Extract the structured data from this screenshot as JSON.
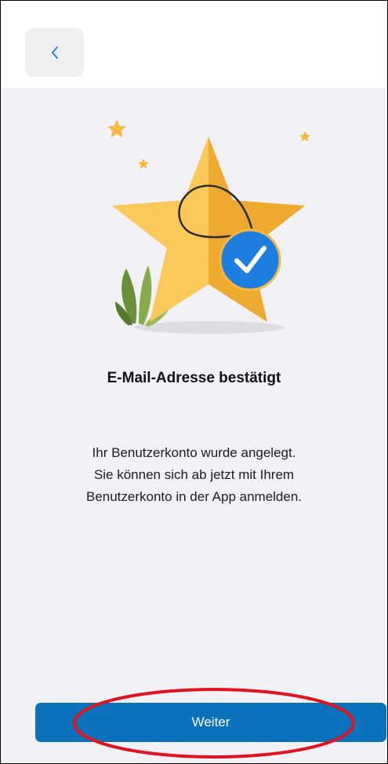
{
  "header": {
    "back_icon": "chevron-left-icon"
  },
  "illustration": {
    "icon": "star-with-checkmark-badge",
    "star_color": "#f6b840",
    "badge_color": "#1f7fe0"
  },
  "content": {
    "title": "E-Mail-Adresse bestätigt",
    "message_lines": [
      "Ihr Benutzerkonto wurde angelegt.",
      "Sie können sich ab jetzt mit Ihrem",
      "Benutzerkonto in der App anmelden."
    ]
  },
  "footer": {
    "continue_label": "Weiter",
    "button_color": "#0a72bd",
    "annotation_color": "#e0141e"
  }
}
